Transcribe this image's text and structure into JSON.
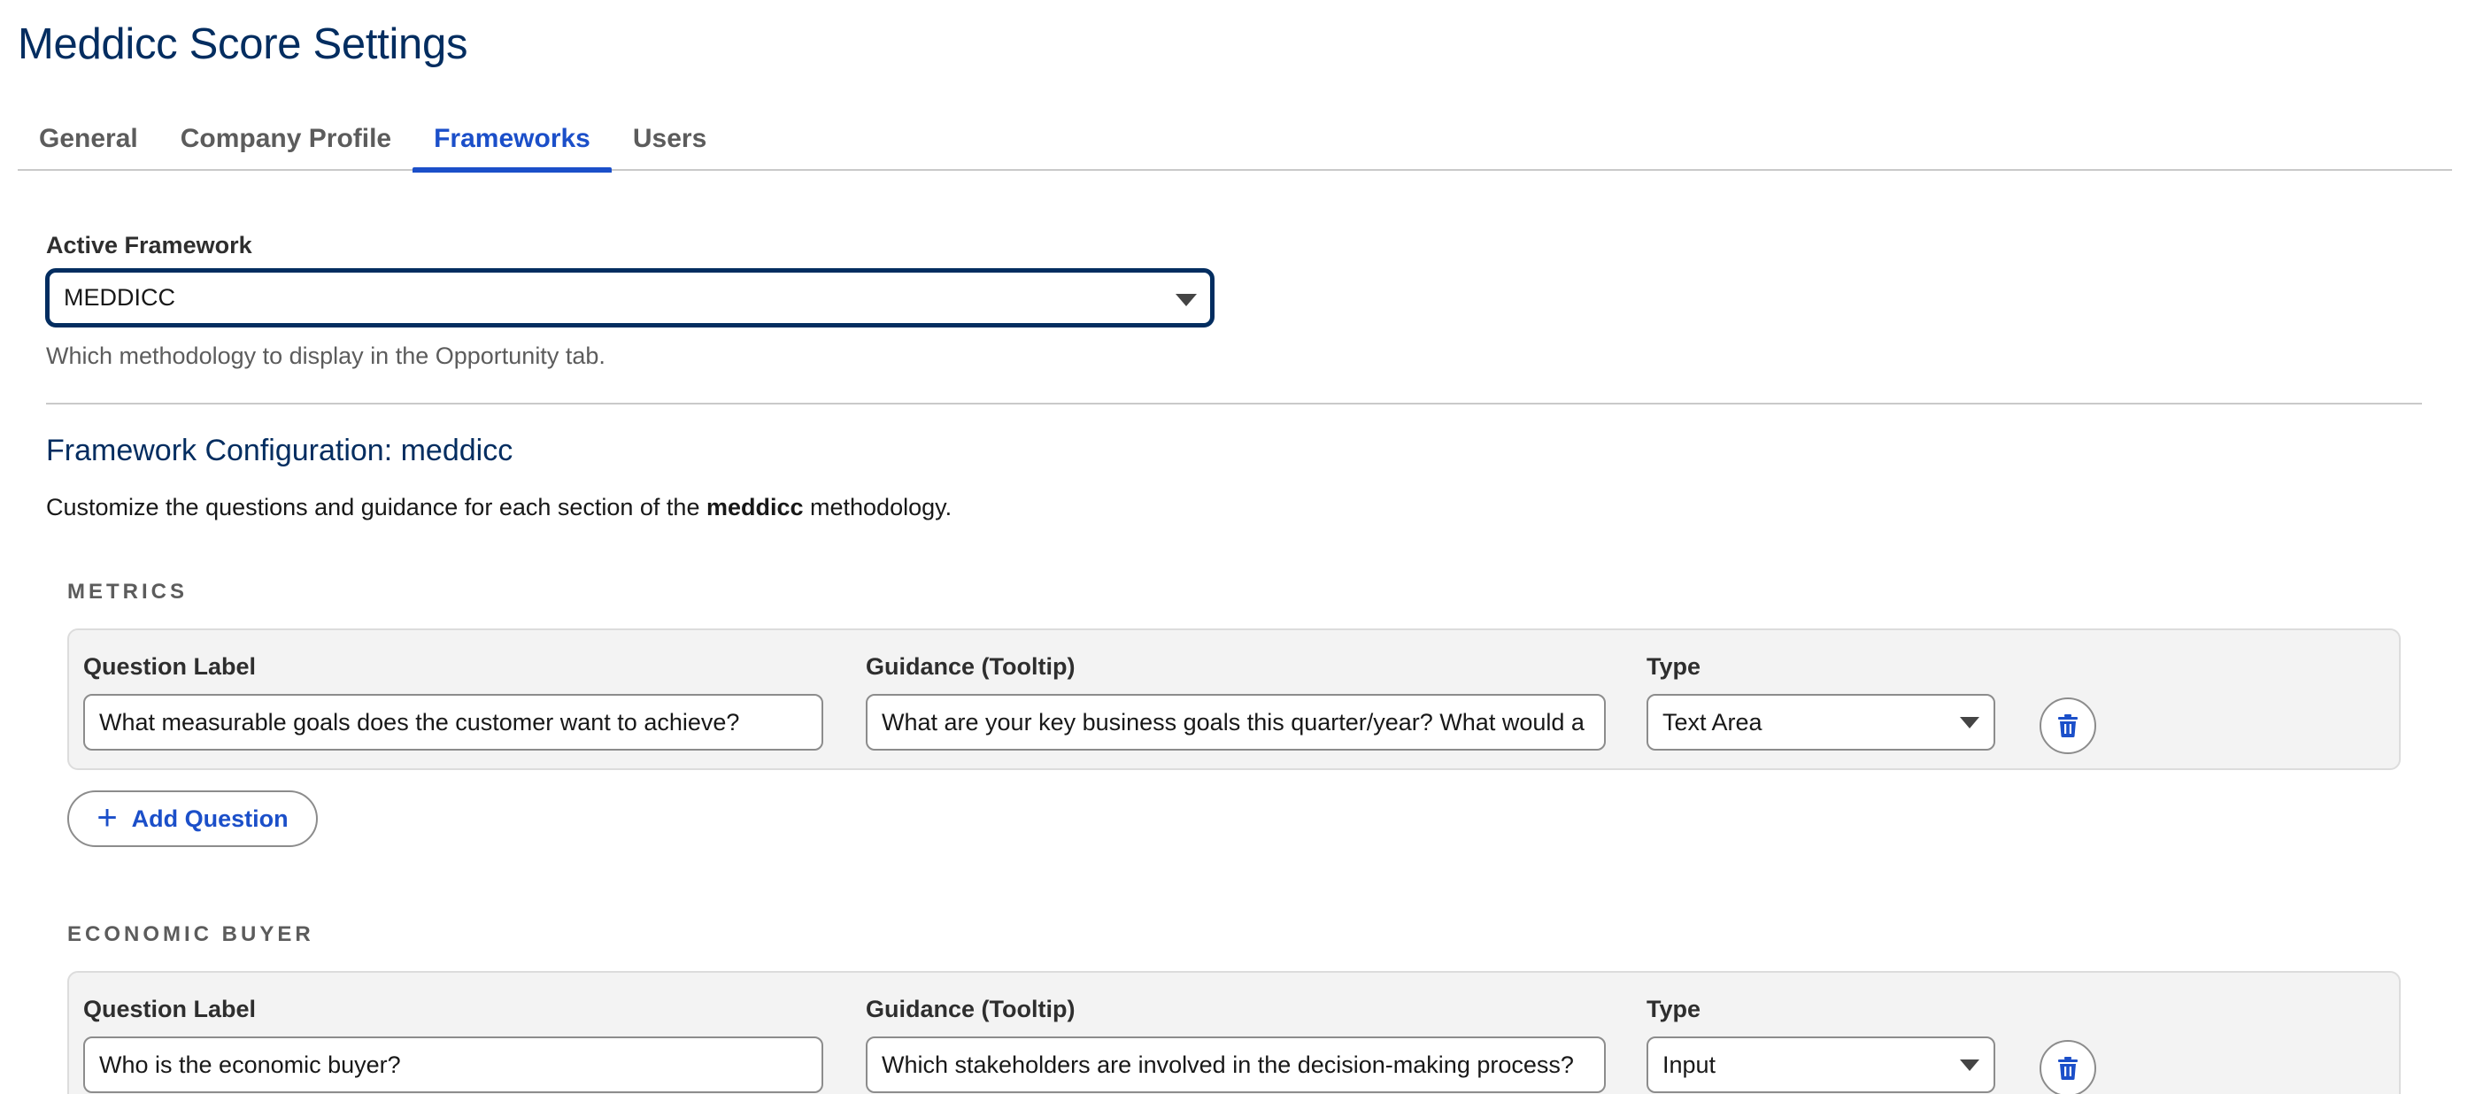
{
  "page": {
    "title": "Meddicc Score Settings"
  },
  "tabs": [
    {
      "label": "General",
      "active": false
    },
    {
      "label": "Company Profile",
      "active": false
    },
    {
      "label": "Frameworks",
      "active": true
    },
    {
      "label": "Users",
      "active": false
    }
  ],
  "active_framework": {
    "label": "Active Framework",
    "value": "MEDDICC",
    "helper": "Which methodology to display in the Opportunity tab."
  },
  "configuration": {
    "heading": "Framework Configuration: meddicc",
    "description_prefix": "Customize the questions and guidance for each section of the ",
    "description_bold": "meddicc",
    "description_suffix": " methodology."
  },
  "column_labels": {
    "question": "Question Label",
    "guidance": "Guidance (Tooltip)",
    "type": "Type"
  },
  "sections": [
    {
      "title": "METRICS",
      "question": "What measurable goals does the customer want to achieve?",
      "guidance": "What are your key business goals this quarter/year? What would a",
      "type": "Text Area"
    },
    {
      "title": "ECONOMIC BUYER",
      "question": "Who is the economic buyer?",
      "guidance": "Which stakeholders are involved in the decision-making process?",
      "type": "Input"
    }
  ],
  "add_question_label": "Add Question",
  "icons": {
    "delete": "trash-icon",
    "add": "plus-icon",
    "dropdown": "caret-down-icon"
  },
  "colors": {
    "accent": "#1b4fc9",
    "title": "#032d60",
    "card_bg": "#f3f3f3"
  }
}
